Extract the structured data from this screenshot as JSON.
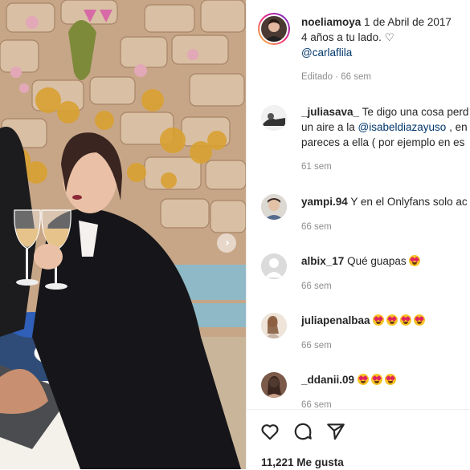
{
  "post": {
    "username": "noeliamoya",
    "date": "1 de Abril de 2017",
    "caption_line": "4 años a tu lado. ♡",
    "caption_mention": "@carlaflila",
    "edited": "Editado · 66 sem"
  },
  "comments": [
    {
      "username": "_juliasava_",
      "line1": "Te digo una cosa perd",
      "line2_pre": "un aire a la ",
      "line2_mention": "@isabeldiazayuso",
      "line2_post": " , en",
      "line3": "pareces a ella ( por ejemplo en es",
      "time": "61 sem"
    },
    {
      "username": "yampi.94",
      "text": "Y en el Onlyfans solo ac",
      "time": "66 sem"
    },
    {
      "username": "albix_17",
      "text": "Qué guapas",
      "emoji_count": 1,
      "time": "66 sem"
    },
    {
      "username": "juliapenalbaa",
      "text": "",
      "emoji_count": 4,
      "time": "66 sem"
    },
    {
      "username": "_ddanii.09",
      "text": "",
      "emoji_count": 3,
      "time": "66 sem"
    }
  ],
  "actions": {
    "like_icon": "heart-outline-icon",
    "comment_icon": "comment-bubble-icon",
    "share_icon": "paper-plane-icon",
    "likes_label": "11,221 Me gusta"
  },
  "colors": {
    "mention": "#00376b",
    "meta": "#8e8e8e",
    "text": "#262626",
    "border": "#efefef"
  }
}
